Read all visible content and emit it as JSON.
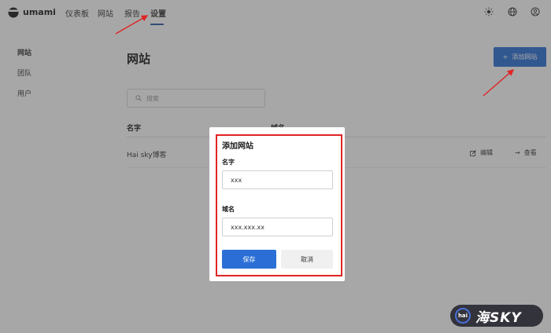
{
  "app": {
    "name": "umami"
  },
  "nav": {
    "items": [
      {
        "label": "仪表板"
      },
      {
        "label": "网站"
      },
      {
        "label": "报告"
      },
      {
        "label": "设置"
      }
    ],
    "active": "设置",
    "icons": [
      "sun-icon",
      "globe-icon",
      "user-icon"
    ]
  },
  "sidebar": {
    "items": [
      {
        "label": "网站"
      },
      {
        "label": "团队"
      },
      {
        "label": "用户"
      }
    ],
    "active": "网站"
  },
  "main": {
    "title": "网站",
    "add_button": "添加网站",
    "search_placeholder": "搜索",
    "columns": [
      "名字",
      "域名"
    ],
    "rows": [
      {
        "name": "Hai sky博客",
        "actions": [
          "编辑",
          "查看"
        ]
      }
    ]
  },
  "modal": {
    "title": "添加网站",
    "name_label": "名字",
    "name_value": "xxx",
    "domain_label": "域名",
    "domain_value": "xxx.xxx.xx",
    "save_label": "保存",
    "cancel_label": "取消"
  },
  "watermark": {
    "badge": "hai",
    "text": "海SKY"
  },
  "colors": {
    "primary": "#2b6fd6",
    "annotation": "#e02424",
    "overlay": "rgba(60,60,60,0.45)"
  }
}
